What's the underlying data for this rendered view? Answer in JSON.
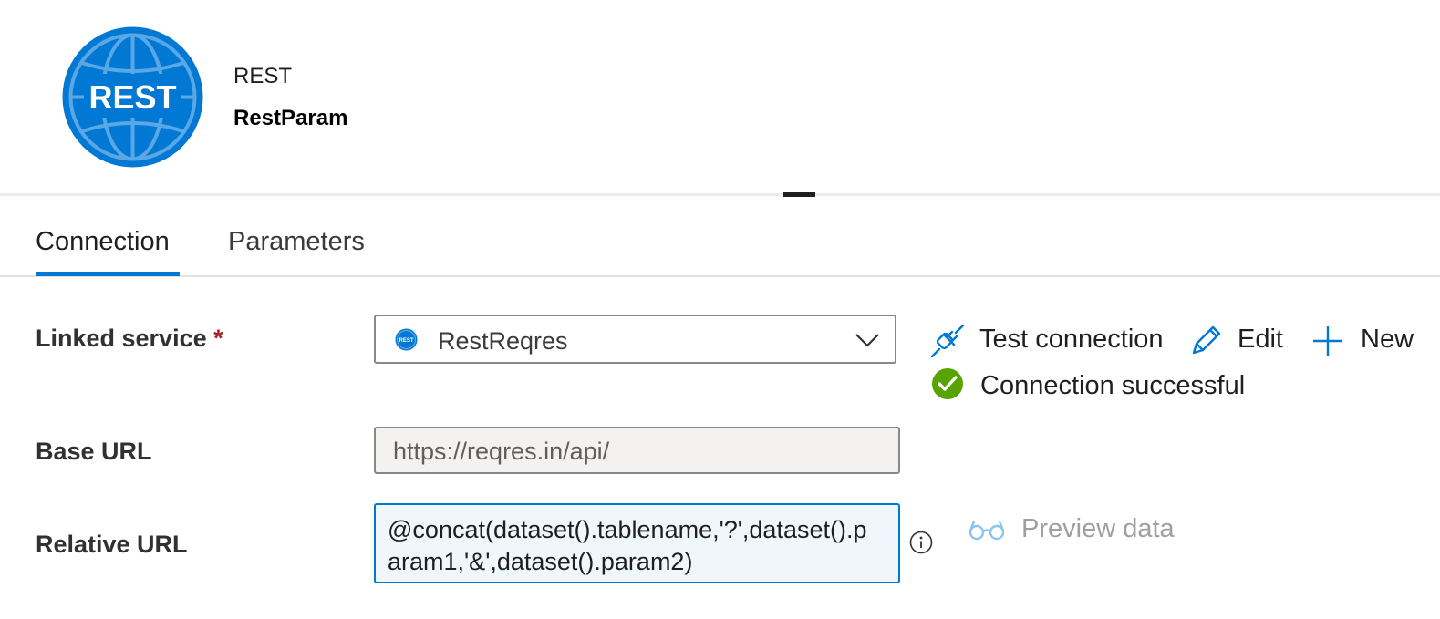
{
  "header": {
    "logo_text": "REST",
    "type_label": "REST",
    "dataset_name": "RestParam"
  },
  "tabs": [
    {
      "label": "Connection",
      "active": true
    },
    {
      "label": "Parameters",
      "active": false
    }
  ],
  "form": {
    "linked_service": {
      "label": "Linked service",
      "required_mark": "*",
      "value": "RestReqres",
      "icon": "rest-service-icon"
    },
    "actions": {
      "test_connection": "Test connection",
      "edit": "Edit",
      "new": "New"
    },
    "status": {
      "text": "Connection successful",
      "color": "#57a300"
    },
    "base_url": {
      "label": "Base URL",
      "value": "https://reqres.in/api/"
    },
    "relative_url": {
      "label": "Relative URL",
      "value": "@concat(dataset().tablename,'?',dataset().param1,'&',dataset().param2)"
    },
    "preview_data": "Preview data"
  },
  "colors": {
    "accent": "#0078d4",
    "success": "#57a300",
    "required": "#a4262c",
    "disabled": "#a19f9d"
  }
}
